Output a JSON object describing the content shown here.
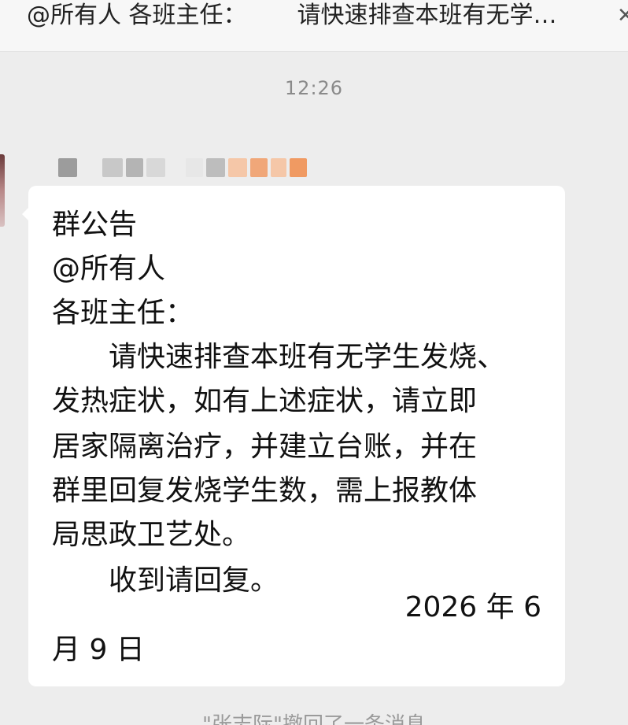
{
  "pinned": {
    "part1": "@所有人 各班主任：",
    "part2": "请快速排查本班有无学…",
    "close_icon": "close-icon"
  },
  "time": "12:26",
  "sender_blur_colors": [
    "#9c9c9c",
    "#c8c8c8",
    "#b4b4b4",
    "#d8d8d8",
    "#e7e7e7",
    "#bdbdbd",
    "#f5c7a8",
    "#f0a779",
    "#f5c7a8",
    "#f09a62"
  ],
  "message": {
    "lines": [
      "群公告",
      "@所有人",
      "各班主任：",
      "　　请快速排查本班有无学生发烧、",
      "发热症状，如有上述症状，请立即",
      "居家隔离治疗，并建立台账，并在",
      "群里回复发烧学生数，需上报教体",
      "局思政卫艺处。",
      "　　收到请回复。"
    ],
    "date_part1": "2026 年 6",
    "date_part2": "月 9 日"
  },
  "recall_notice": "\"张志际\"撤回了一条消息"
}
